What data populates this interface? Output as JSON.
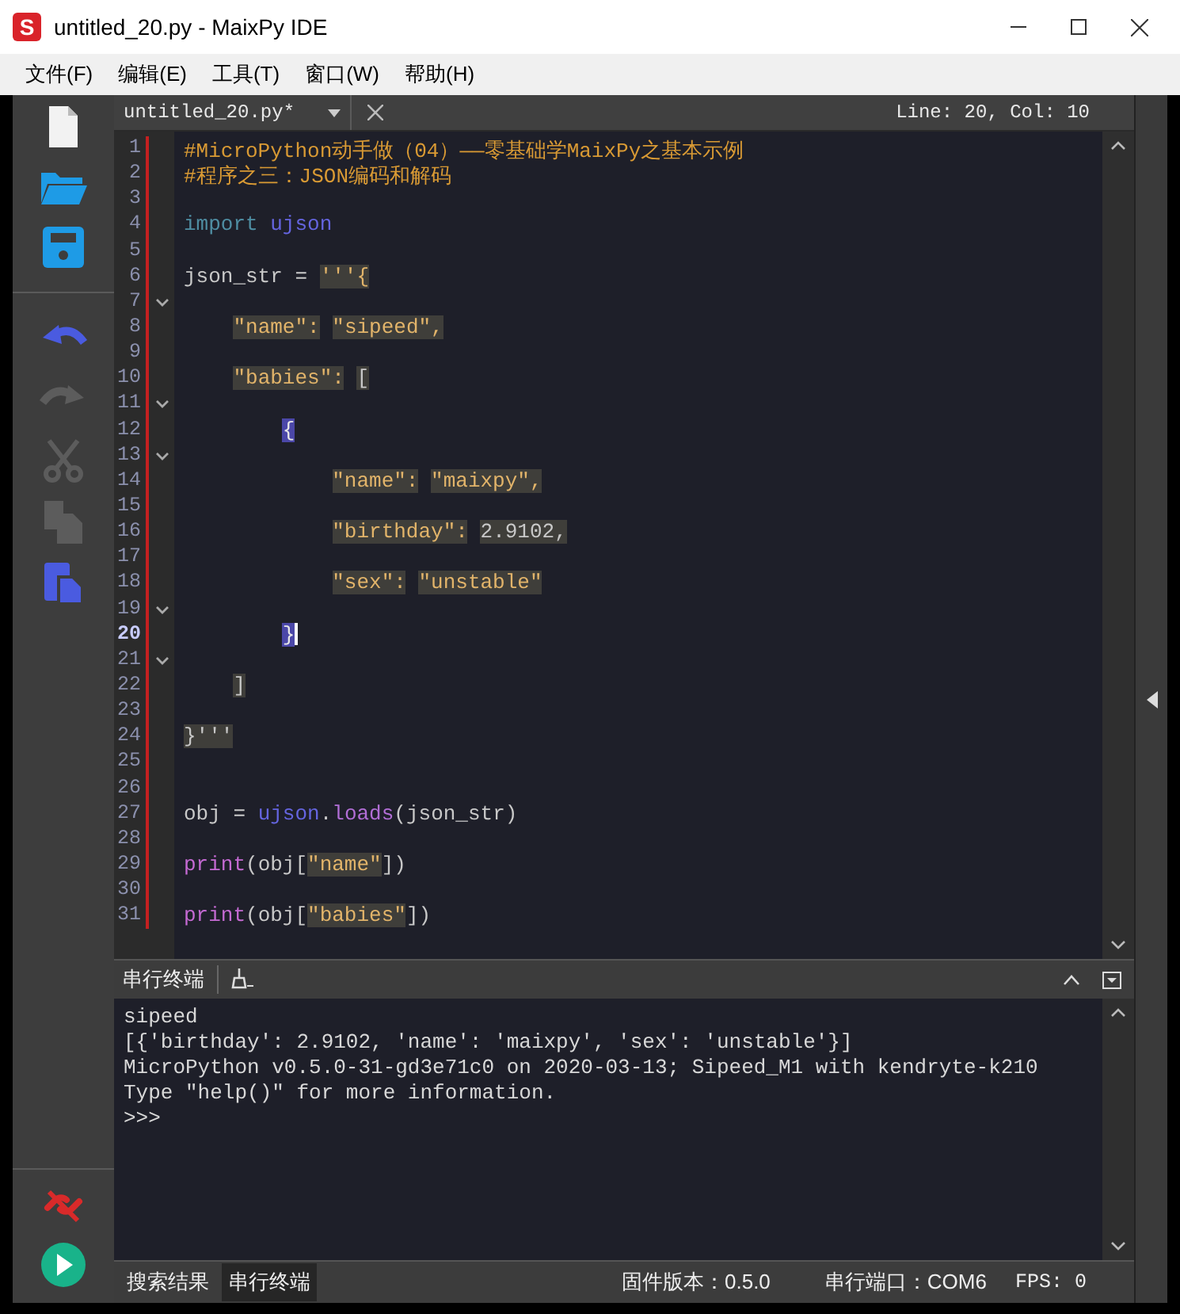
{
  "window": {
    "logo_text": "S",
    "title": "untitled_20.py - MaixPy IDE"
  },
  "menu": [
    "文件(F)",
    "编辑(E)",
    "工具(T)",
    "窗口(W)",
    "帮助(H)"
  ],
  "toolbar": {
    "items": [
      {
        "kind": "new",
        "disabled": false
      },
      {
        "kind": "open",
        "disabled": false
      },
      {
        "kind": "save",
        "disabled": false
      },
      {
        "kind": "undo",
        "disabled": false
      },
      {
        "kind": "redo",
        "disabled": true
      },
      {
        "kind": "cut",
        "disabled": true
      },
      {
        "kind": "copy",
        "disabled": true
      },
      {
        "kind": "paste",
        "disabled": false
      }
    ],
    "device_items": [
      {
        "kind": "disconnect"
      },
      {
        "kind": "run"
      }
    ]
  },
  "editor": {
    "file_tab": "untitled_20.py*",
    "position": "Line: 20, Col: 10",
    "lines": [
      {
        "number": "1",
        "fold": false,
        "current": false,
        "tokens": [
          {
            "text": "#MicroPython动手做（04）——零基础学MaixPy之基本示例",
            "kind": "comment"
          }
        ]
      },
      {
        "number": "2",
        "fold": false,
        "current": false,
        "tokens": [
          {
            "text": "#程序之三：JSON编码和解码",
            "kind": "comment"
          }
        ]
      },
      {
        "number": "3",
        "fold": false,
        "current": false
      },
      {
        "number": "4",
        "fold": false,
        "current": false,
        "tokens": [
          {
            "text": "import ",
            "kind": "keyword"
          },
          {
            "text": "ujson",
            "kind": "module"
          }
        ]
      },
      {
        "number": "5",
        "fold": false,
        "current": false
      },
      {
        "number": "6",
        "fold": false,
        "current": false,
        "tokens": [
          {
            "text": "json_str = ",
            "kind": "plain"
          },
          {
            "text": "'''{",
            "kind": "string"
          }
        ]
      },
      {
        "number": "7",
        "fold": true,
        "current": false
      },
      {
        "number": "8",
        "fold": false,
        "current": false,
        "tokens": [
          {
            "text": "    \"name\": ",
            "kind": "string"
          },
          {
            "text": "\"sipeed\",",
            "kind": "string"
          }
        ]
      },
      {
        "number": "9",
        "fold": false,
        "current": false
      },
      {
        "number": "10",
        "fold": false,
        "current": false,
        "tokens": [
          {
            "text": "    \"babies\": ",
            "kind": "string"
          },
          {
            "text": "[",
            "kind": "literal"
          }
        ]
      },
      {
        "number": "11",
        "fold": true,
        "current": false
      },
      {
        "number": "12",
        "fold": false,
        "current": false,
        "tokens": [
          {
            "text": "        {",
            "kind": "match"
          }
        ]
      },
      {
        "number": "13",
        "fold": true,
        "current": false
      },
      {
        "number": "14",
        "fold": false,
        "current": false,
        "tokens": [
          {
            "text": "            \"name\": ",
            "kind": "string"
          },
          {
            "text": "\"maixpy\",",
            "kind": "string"
          }
        ]
      },
      {
        "number": "15",
        "fold": false,
        "current": false
      },
      {
        "number": "16",
        "fold": false,
        "current": false,
        "tokens": [
          {
            "text": "            \"birthday\": ",
            "kind": "string"
          },
          {
            "text": "2.9102,",
            "kind": "literal"
          }
        ]
      },
      {
        "number": "17",
        "fold": false,
        "current": false
      },
      {
        "number": "18",
        "fold": false,
        "current": false,
        "tokens": [
          {
            "text": "            \"sex\": ",
            "kind": "string"
          },
          {
            "text": "\"unstable\"",
            "kind": "string"
          }
        ]
      },
      {
        "number": "19",
        "fold": true,
        "current": false
      },
      {
        "number": "20",
        "fold": false,
        "current": true,
        "tokens": [
          {
            "text": "        }",
            "kind": "match"
          }
        ]
      },
      {
        "number": "21",
        "fold": true,
        "current": false
      },
      {
        "number": "22",
        "fold": false,
        "current": false,
        "tokens": [
          {
            "text": "    ]",
            "kind": "literal"
          }
        ]
      },
      {
        "number": "23",
        "fold": false,
        "current": false
      },
      {
        "number": "24",
        "fold": false,
        "current": false,
        "tokens": [
          {
            "text": "}'''",
            "kind": "literal"
          }
        ]
      },
      {
        "number": "25",
        "fold": false,
        "current": false
      },
      {
        "number": "26",
        "fold": false,
        "current": false
      },
      {
        "number": "27",
        "fold": false,
        "current": false,
        "tokens": [
          {
            "text": "obj = ",
            "kind": "plain"
          },
          {
            "text": "ujson",
            "kind": "module"
          },
          {
            "text": ".",
            "kind": "plain"
          },
          {
            "text": "loads",
            "kind": "method"
          },
          {
            "text": "(json_str)",
            "kind": "plain"
          }
        ]
      },
      {
        "number": "28",
        "fold": false,
        "current": false
      },
      {
        "number": "29",
        "fold": false,
        "current": false,
        "tokens": [
          {
            "text": "print",
            "kind": "builtin"
          },
          {
            "text": "(obj[",
            "kind": "plain"
          },
          {
            "text": "\"name\"",
            "kind": "string"
          },
          {
            "text": "])",
            "kind": "plain"
          }
        ]
      },
      {
        "number": "30",
        "fold": false,
        "current": false
      },
      {
        "number": "31",
        "fold": false,
        "current": false,
        "tokens": [
          {
            "text": "print",
            "kind": "builtin"
          },
          {
            "text": "(obj[",
            "kind": "plain"
          },
          {
            "text": "\"babies\"",
            "kind": "string"
          },
          {
            "text": "])",
            "kind": "plain"
          }
        ]
      }
    ]
  },
  "terminal": {
    "title": "串行终端",
    "lines": [
      "sipeed",
      "[{'birthday': 2.9102, 'name': 'maixpy', 'sex': 'unstable'}]",
      "MicroPython v0.5.0-31-gd3e71c0 on 2020-03-13; Sipeed_M1 with kendryte-k210",
      "Type \"help()\" for more information.",
      ">>>"
    ]
  },
  "status_bar": {
    "tabs": [
      {
        "label": "搜索结果",
        "selected": false
      },
      {
        "label": "串行终端",
        "selected": true
      }
    ],
    "firmware": "固件版本：0.5.0",
    "port": "串行端口：COM6",
    "fps": "FPS: 0"
  }
}
